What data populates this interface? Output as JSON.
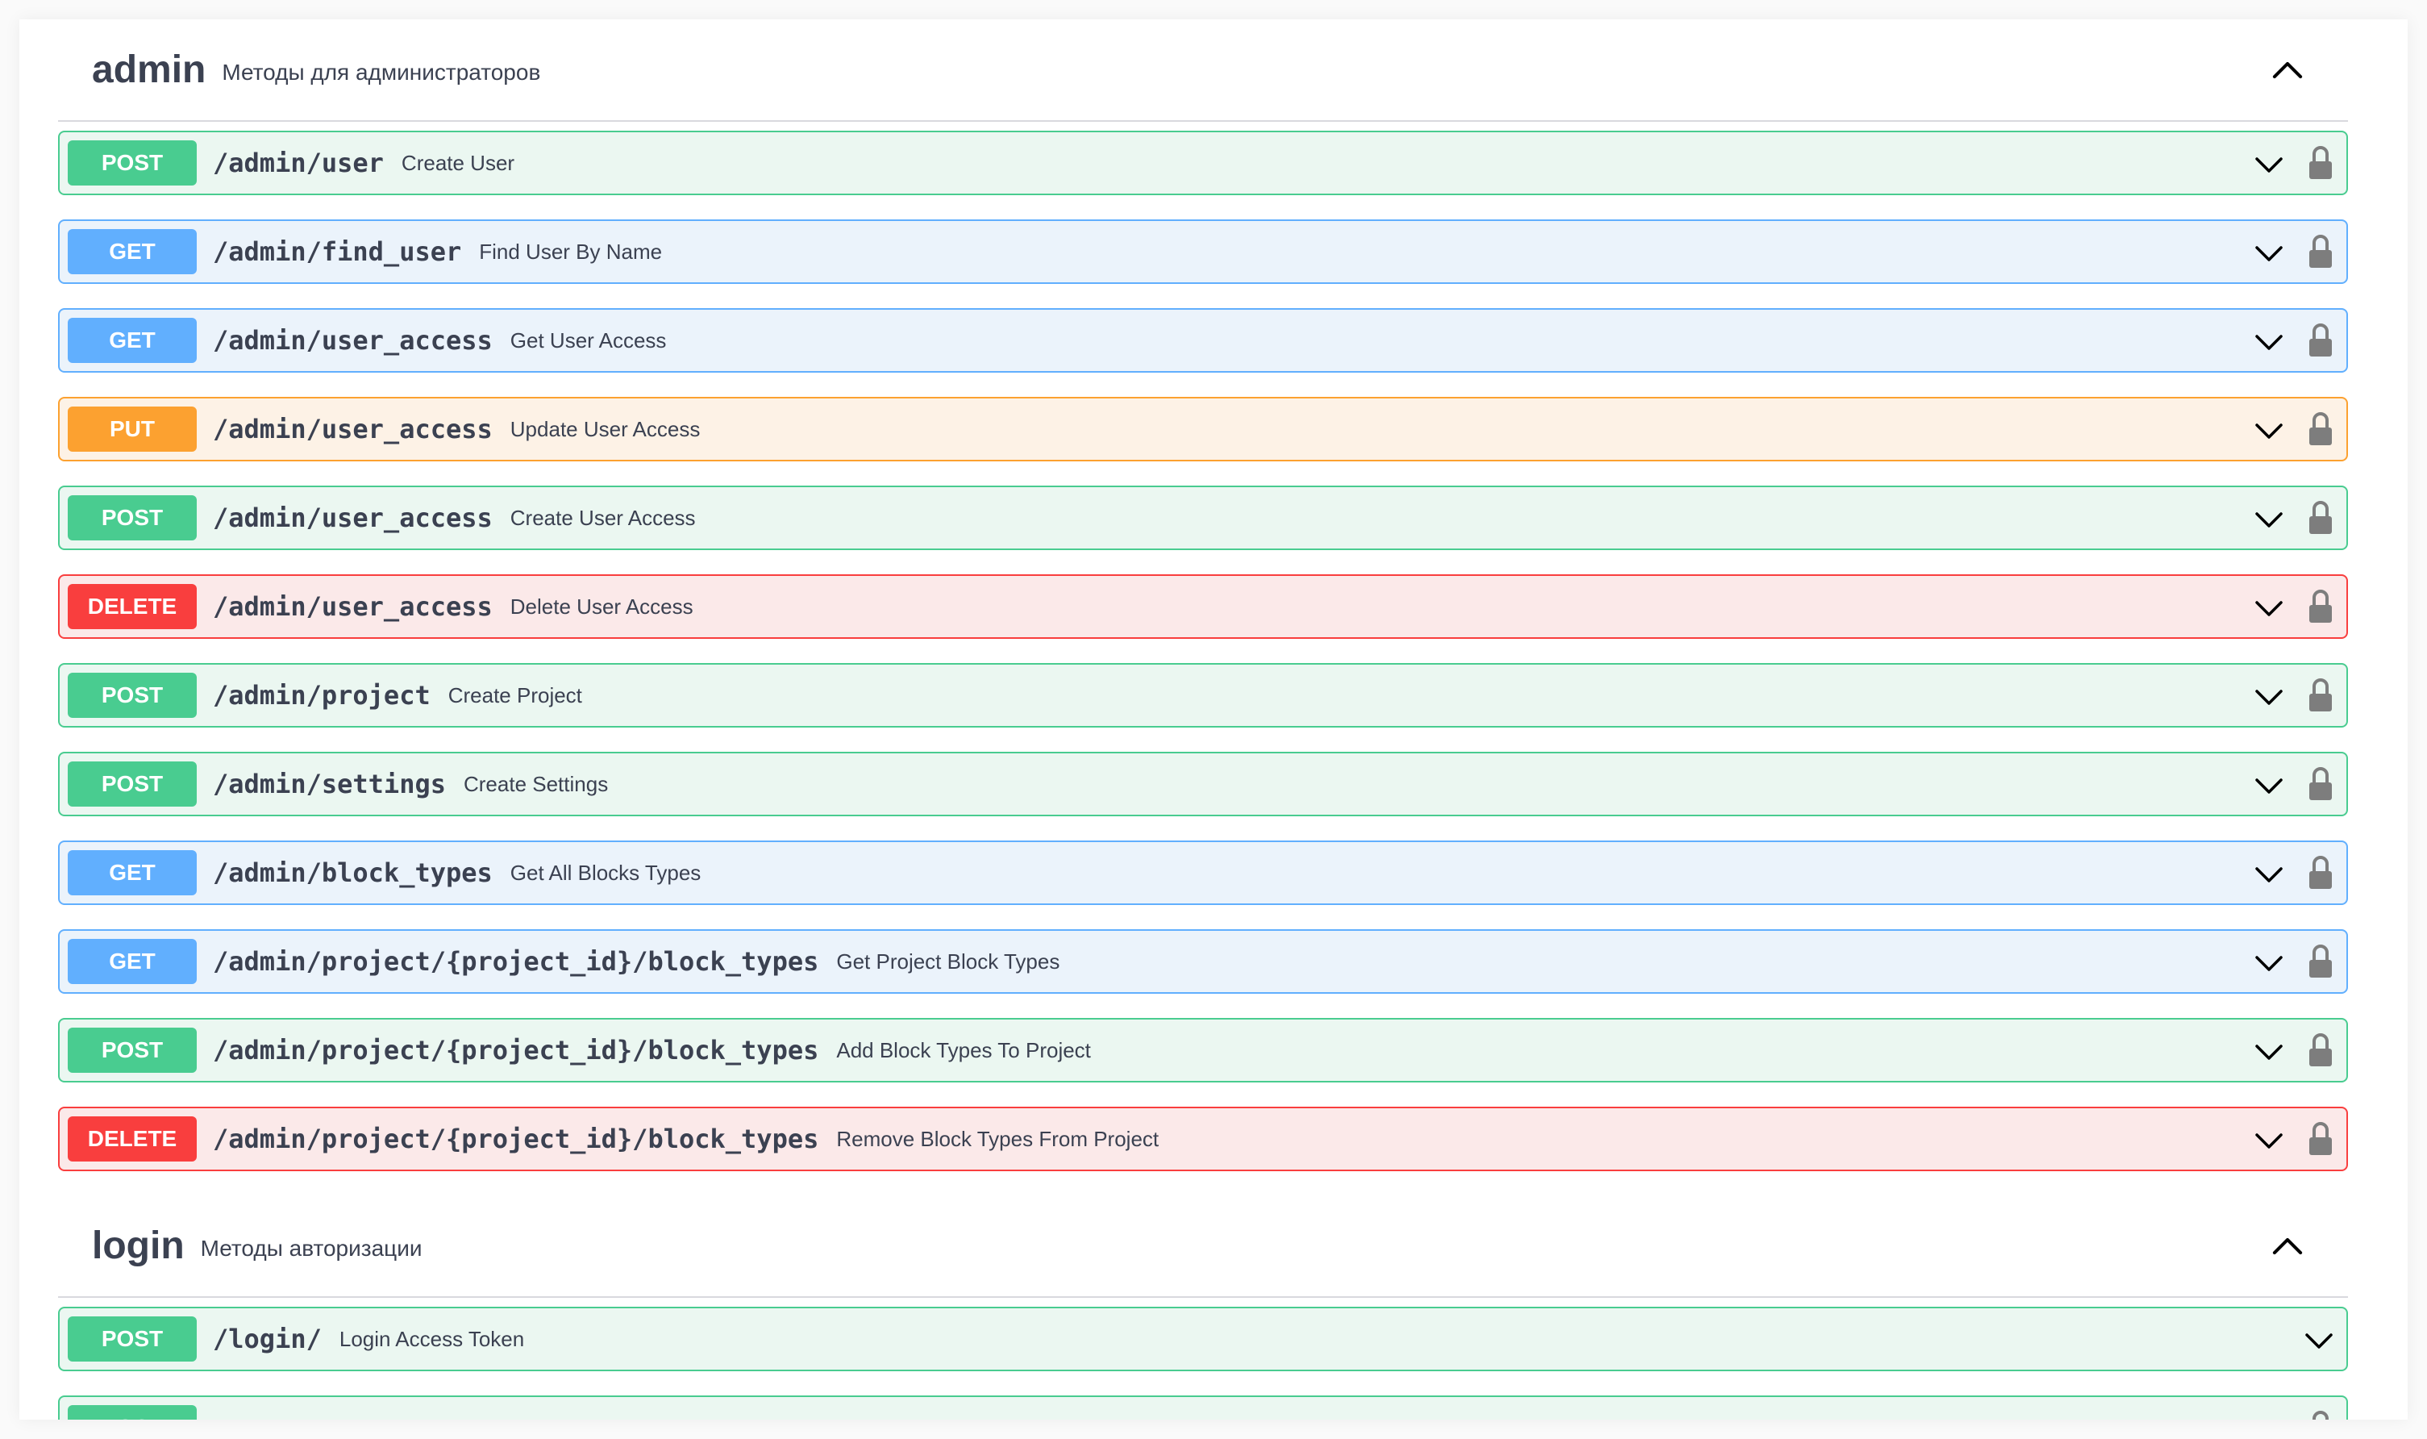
{
  "sections": [
    {
      "name": "admin",
      "description": "Методы для администраторов",
      "operations": [
        {
          "method": "POST",
          "path": "/admin/user",
          "summary": "Create User"
        },
        {
          "method": "GET",
          "path": "/admin/find_user",
          "summary": "Find User By Name"
        },
        {
          "method": "GET",
          "path": "/admin/user_access",
          "summary": "Get User Access"
        },
        {
          "method": "PUT",
          "path": "/admin/user_access",
          "summary": "Update User Access"
        },
        {
          "method": "POST",
          "path": "/admin/user_access",
          "summary": "Create User Access"
        },
        {
          "method": "DELETE",
          "path": "/admin/user_access",
          "summary": "Delete User Access"
        },
        {
          "method": "POST",
          "path": "/admin/project",
          "summary": "Create Project"
        },
        {
          "method": "POST",
          "path": "/admin/settings",
          "summary": "Create Settings"
        },
        {
          "method": "GET",
          "path": "/admin/block_types",
          "summary": "Get All Blocks Types"
        },
        {
          "method": "GET",
          "path": "/admin/project/{project_id}/block_types",
          "summary": "Get Project Block Types"
        },
        {
          "method": "POST",
          "path": "/admin/project/{project_id}/block_types",
          "summary": "Add Block Types To Project"
        },
        {
          "method": "DELETE",
          "path": "/admin/project/{project_id}/block_types",
          "summary": "Remove Block Types From Project"
        }
      ]
    },
    {
      "name": "login",
      "description": "Методы авторизации",
      "operations": [
        {
          "method": "POST",
          "path": "/login/",
          "summary": "Login Access Token"
        },
        {
          "method": "POST",
          "path": "",
          "summary": ""
        }
      ]
    }
  ],
  "colors": {
    "post": "#49cc90",
    "get": "#61affe",
    "put": "#fca130",
    "delete": "#f93e3e",
    "text": "#3b4151"
  },
  "icons": {
    "collapse": "chevron-up-icon",
    "expand": "chevron-down-icon",
    "auth": "lock-icon"
  }
}
